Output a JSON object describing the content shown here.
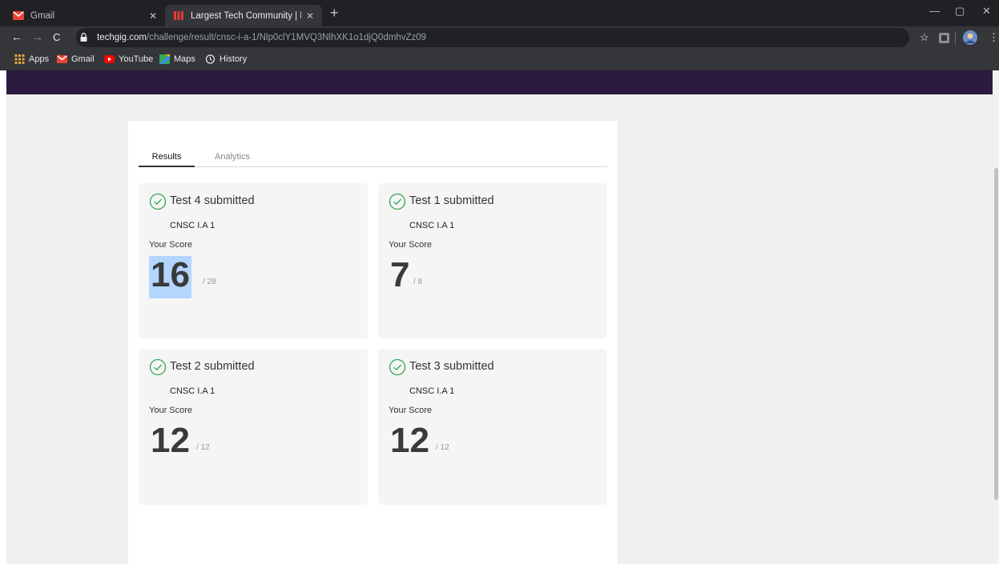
{
  "browser": {
    "tabs": [
      {
        "title": "Gmail",
        "active": false
      },
      {
        "title": "Largest Tech Community | Hackat",
        "active": true
      }
    ],
    "url_host": "techgig.com",
    "url_path": "/challenge/result/cnsc-i-a-1/Nlp0clY1MVQ3NlhXK1o1djQ0dmhvZz09",
    "bookmarks": [
      "Apps",
      "Gmail",
      "YouTube",
      "Maps",
      "History"
    ],
    "colors": {
      "tabstrip": "#202124",
      "toolbar": "#35363a"
    }
  },
  "page": {
    "tabs": {
      "results": "Results",
      "analytics": "Analytics"
    },
    "cards": [
      {
        "title": "Test 4 submitted",
        "subject": "CNSC I.A 1",
        "score_label": "Your Score",
        "score": "16",
        "total": "/ 28",
        "selected": true
      },
      {
        "title": "Test 1 submitted",
        "subject": "CNSC I.A 1",
        "score_label": "Your Score",
        "score": "7",
        "total": "/ 8",
        "selected": false
      },
      {
        "title": "Test 2 submitted",
        "subject": "CNSC I.A 1",
        "score_label": "Your Score",
        "score": "12",
        "total": "/ 12",
        "selected": false
      },
      {
        "title": "Test 3 submitted",
        "subject": "CNSC I.A 1",
        "score_label": "Your Score",
        "score": "12",
        "total": "/ 12",
        "selected": false
      }
    ],
    "colors": {
      "header_band": "#2c1a3f",
      "check": "#34a853",
      "selection": "#b4d5fe"
    }
  }
}
